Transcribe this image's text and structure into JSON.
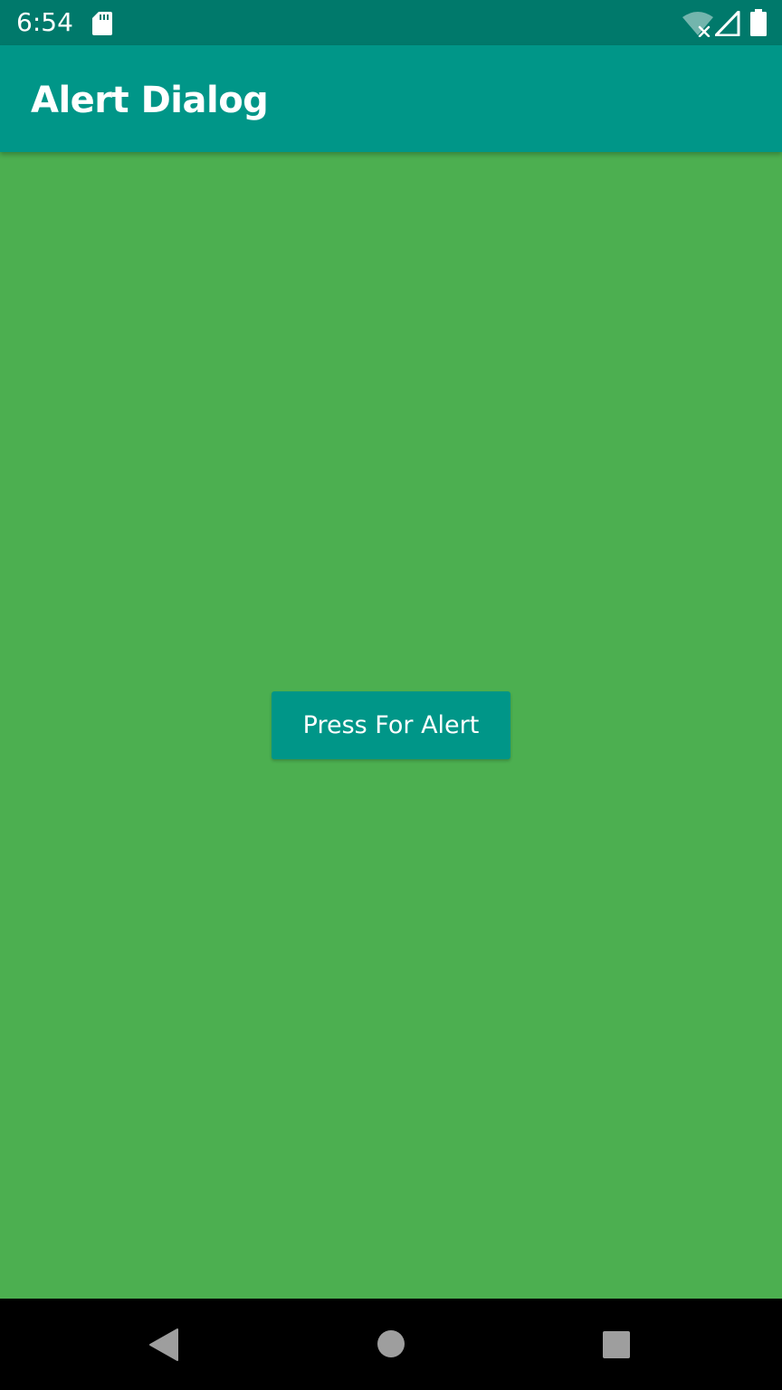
{
  "status_bar": {
    "time": "6:54",
    "icons": [
      "sd-card-icon",
      "wifi-off-icon",
      "signal-icon",
      "battery-icon"
    ]
  },
  "app_bar": {
    "title": "Alert Dialog",
    "color": "#009688"
  },
  "main": {
    "background_color": "#4caf50",
    "button_label": "Press For Alert",
    "button_color": "#009688"
  },
  "nav_bar": {
    "icons": [
      "back-icon",
      "home-icon",
      "recents-icon"
    ]
  }
}
